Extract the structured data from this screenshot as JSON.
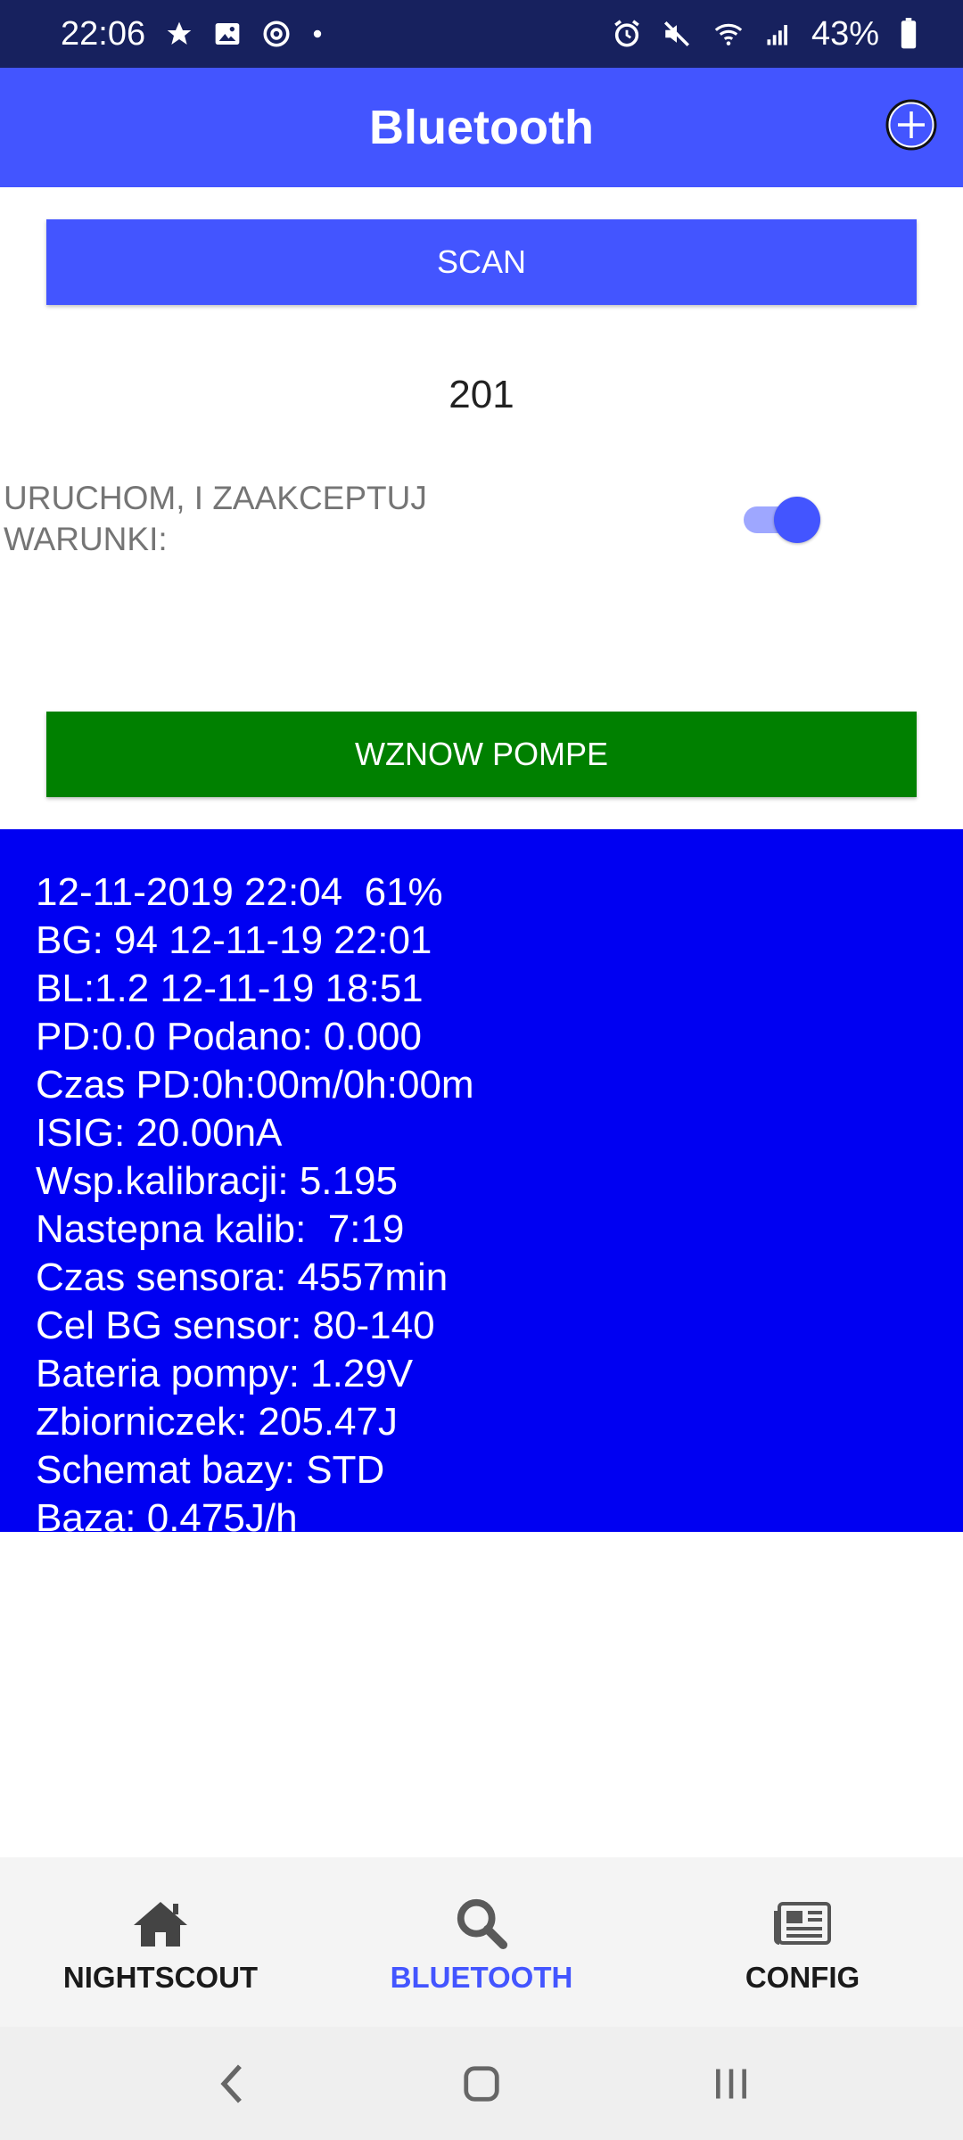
{
  "status_bar": {
    "time": "22:06",
    "battery": "43%",
    "left_icons": [
      "star-icon",
      "gallery-icon",
      "at-sign-icon",
      "dot-icon"
    ],
    "right_icons": [
      "alarm-icon",
      "mute-icon",
      "wifi-icon",
      "signal-icon",
      "battery-icon"
    ]
  },
  "app_bar": {
    "title": "Bluetooth",
    "action_icon": "add-circle-icon"
  },
  "main": {
    "scan_label": "SCAN",
    "counter": "201",
    "consent_label": "URUCHOM, I ZAAKCEPTUJ WARUNKI:",
    "consent_toggle_on": true,
    "resume_label": "WZNOW POMPE"
  },
  "info_lines": [
    "12-11-2019 22:04  61%",
    "BG: 94 12-11-19 22:01",
    "BL:1.2 12-11-19 18:51",
    "PD:0.0 Podano: 0.000",
    "Czas PD:0h:00m/0h:00m",
    "ISIG: 20.00nA",
    "Wsp.kalibracji: 5.195",
    "Nastepna kalib:  7:19",
    "Czas sensora: 4557min",
    "Cel BG sensor: 80-140",
    "Bateria pompy: 1.29V",
    "Zbiorniczek: 205.47J",
    "Schemat bazy: STD",
    "Baza: 0.475J/h"
  ],
  "bottom_nav": [
    {
      "label": "NIGHTSCOUT",
      "icon": "home-icon",
      "active": false
    },
    {
      "label": "BLUETOOTH",
      "icon": "search-icon",
      "active": true
    },
    {
      "label": "CONFIG",
      "icon": "newspaper-icon",
      "active": false
    }
  ],
  "system_nav": [
    "back-icon",
    "home-button-icon",
    "recents-icon"
  ],
  "colors": {
    "status_bar": "#17215e",
    "primary": "#4355ff",
    "resume_green": "#008000",
    "info_panel": "#0000f2"
  }
}
